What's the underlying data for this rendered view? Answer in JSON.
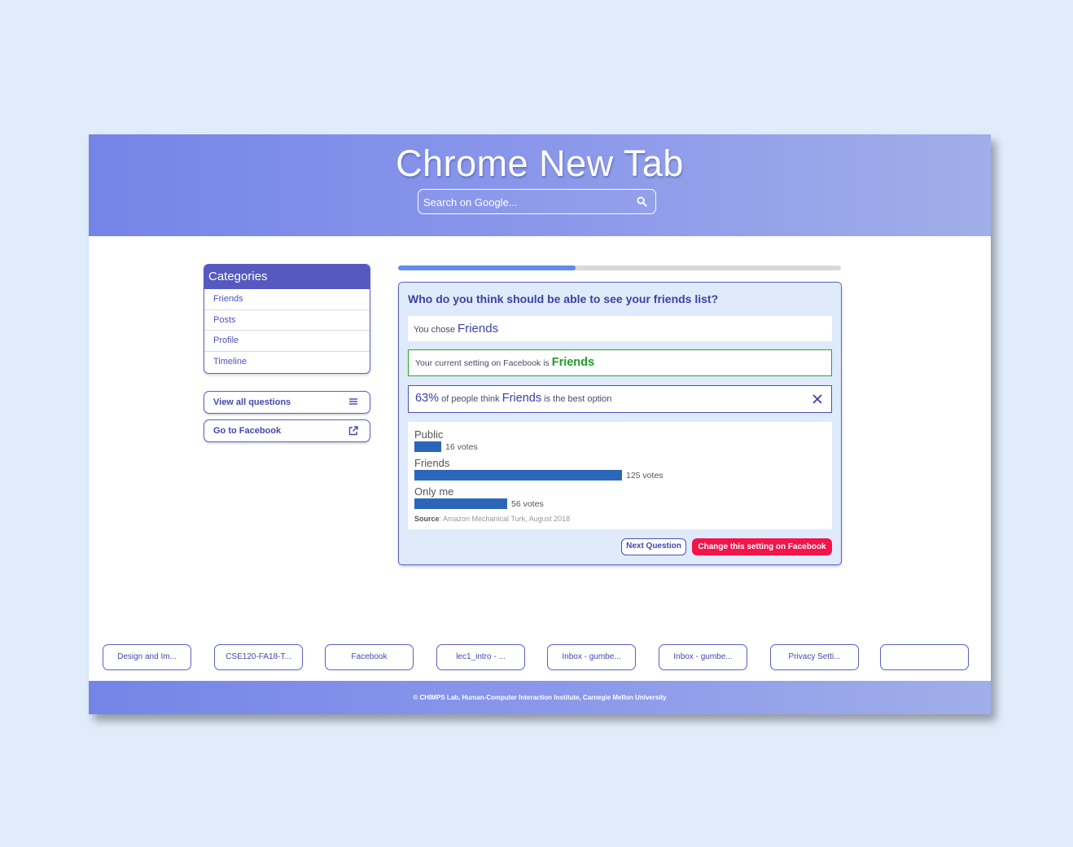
{
  "header": {
    "title": "Chrome New Tab",
    "search_placeholder": "Search on Google..."
  },
  "sidebar": {
    "categories_title": "Categories",
    "categories": [
      "Friends",
      "Posts",
      "Profile",
      "Timeline"
    ],
    "view_all_label": "View all questions",
    "go_facebook_label": "Go to Facebook"
  },
  "progress": {
    "fraction": 0.4
  },
  "question": {
    "text": "Who do you think should be able to see your friends list?",
    "chose_prefix": "You chose",
    "chose_value": "Friends",
    "current_prefix": "Your current setting on Facebook is",
    "current_value": "Friends",
    "stat_percent": "63%",
    "stat_mid": "of people think",
    "stat_option": "Friends",
    "stat_suffix": "is the best option",
    "source_label": "Source",
    "source_text": ": Amazon Mechanical Turk, August 2018",
    "next_label": "Next Question",
    "change_label": "Change this setting on Facebook"
  },
  "chart_data": {
    "type": "bar",
    "categories": [
      "Public",
      "Friends",
      "Only me"
    ],
    "values": [
      16,
      125,
      56
    ],
    "value_labels": [
      "16 votes",
      "125 votes",
      "56 votes"
    ],
    "xlabel": "",
    "ylabel": ""
  },
  "shortcuts": [
    "Design and Im...",
    "CSE120-FA18-T...",
    "Facebook",
    "lec1_intro - ...",
    "Inbox - gumbe...",
    "Inbox - gumbe...",
    "Privacy Setti...",
    ""
  ],
  "footer": {
    "text": "© CHIMPS Lab, Human-Computer Interaction Institute, Carnegie Mellon University"
  },
  "colors": {
    "accent": "#5559c0",
    "header_gradient_start": "#7485e8",
    "header_gradient_end": "#a0aee9",
    "bar": "#2c66bb",
    "current_setting_border": "#2aa52a",
    "change_button": "#f5144a"
  }
}
